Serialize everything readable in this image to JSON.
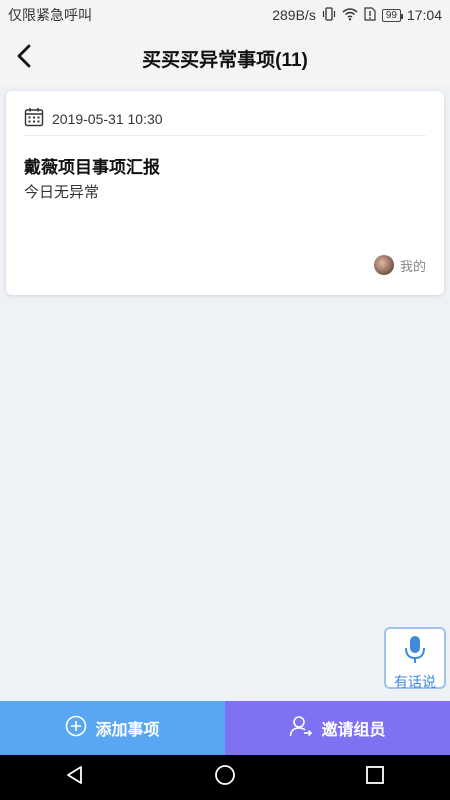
{
  "status_bar": {
    "left_text": "仅限紧急呼叫",
    "network_speed": "289B/s",
    "battery": "99",
    "time": "17:04"
  },
  "header": {
    "title": "买买买异常事项(11)"
  },
  "cards": [
    {
      "date": "2019-05-31 10:30",
      "title": "戴薇项目事项汇报",
      "content": "今日无异常",
      "author": "我的"
    }
  ],
  "voice_button": {
    "label": "有话说"
  },
  "bottom_bar": {
    "add_label": "添加事项",
    "invite_label": "邀请组员"
  },
  "colors": {
    "add_button": "#59a6f3",
    "invite_button": "#7e72f2",
    "voice_accent": "#3f8bd9"
  },
  "icons": [
    "back-arrow-icon",
    "calendar-icon",
    "mic-icon",
    "plus-circle-icon",
    "add-user-icon",
    "nav-back-icon",
    "nav-home-icon",
    "nav-recent-icon"
  ]
}
